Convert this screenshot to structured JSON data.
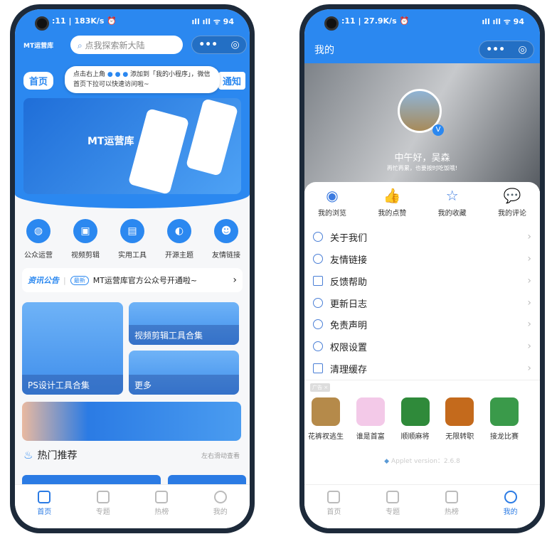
{
  "left": {
    "status": {
      "time": ":11 | 183K/s ⏰",
      "right": "ıll ıll ᯤ 94"
    },
    "logo": "MT运营库",
    "search_placeholder": "点我探索新大陆",
    "capsule": {
      "more": "•••",
      "close": "◎"
    },
    "tab_home": "首页",
    "tab_notice": "通知",
    "tooltip": {
      "line1a": "点击右上角",
      "dots": "● ● ●",
      "line1b": "添加到「我的小程序」，微信",
      "line2": "首页下拉可以快速访问啦~"
    },
    "banner_logo": "MT运营库",
    "categories": [
      {
        "label": "公众运营",
        "icon": "wechat-icon"
      },
      {
        "label": "视频剪辑",
        "icon": "video-icon"
      },
      {
        "label": "实用工具",
        "icon": "toolbox-icon"
      },
      {
        "label": "开源主题",
        "icon": "palette-icon"
      },
      {
        "label": "友情链接",
        "icon": "user-icon"
      }
    ],
    "notice": {
      "brand_a": "资讯",
      "brand_b": "公告",
      "badge": "最新",
      "text": "MT运营库官方公众号开通啦~",
      "chevron": "›"
    },
    "cards": {
      "ps": "PS设计工具合集",
      "video": "视频剪辑工具合集",
      "more": "更多"
    },
    "hot": {
      "title": "热门推荐",
      "hint": "左右滑动查看"
    },
    "tabbar": [
      {
        "label": "首页",
        "active": true
      },
      {
        "label": "专题"
      },
      {
        "label": "热榜"
      },
      {
        "label": "我的"
      }
    ]
  },
  "right": {
    "status": {
      "time": ":11 | 27.9K/s ⏰",
      "right": "ıll ıll ᯤ 94"
    },
    "title": "我的",
    "capsule": {
      "more": "•••",
      "close": "◎"
    },
    "greeting": "中午好，吴森",
    "subtext": "再忙再累，也要按时吃饭哦!",
    "vip": "V",
    "quick": [
      {
        "label": "我的浏览",
        "icon": "eye-icon",
        "glyph": "◉"
      },
      {
        "label": "我的点赞",
        "icon": "thumbs-up-icon",
        "glyph": "👍"
      },
      {
        "label": "我的收藏",
        "icon": "star-icon",
        "glyph": "☆"
      },
      {
        "label": "我的评论",
        "icon": "comment-icon",
        "glyph": "💬"
      }
    ],
    "menu": [
      {
        "label": "关于我们",
        "icon": "info-icon"
      },
      {
        "label": "友情链接",
        "icon": "link-icon"
      },
      {
        "label": "反馈帮助",
        "icon": "feedback-icon"
      },
      {
        "label": "更新日志",
        "icon": "upload-icon"
      },
      {
        "label": "免责声明",
        "icon": "shield-icon"
      },
      {
        "label": "权限设置",
        "icon": "gear-icon"
      },
      {
        "label": "清理缓存",
        "icon": "trash-icon"
      }
    ],
    "ad_label": "广告 ×",
    "games": [
      {
        "label": "花裤衩逃生",
        "color": "#b58a4a"
      },
      {
        "label": "谁是首富",
        "color": "#f3c9e8"
      },
      {
        "label": "顺顺麻将",
        "color": "#2f8a3a"
      },
      {
        "label": "无限转职",
        "color": "#c46a1c"
      },
      {
        "label": "接龙比赛",
        "color": "#3a9a4a"
      }
    ],
    "version": "Applet version：2.6.8",
    "tabbar": [
      {
        "label": "首页"
      },
      {
        "label": "专题"
      },
      {
        "label": "热榜"
      },
      {
        "label": "我的",
        "active": true
      }
    ]
  }
}
